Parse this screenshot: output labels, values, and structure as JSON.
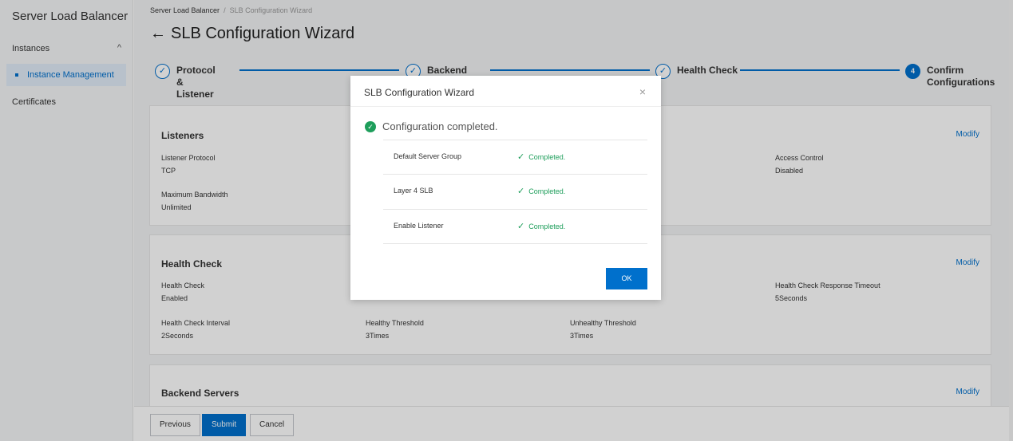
{
  "sidebar": {
    "brand": "Server Load Balancer",
    "group_label": "Instances",
    "items": [
      {
        "label": "Instance Management",
        "active": true
      },
      {
        "label": "Certificates",
        "active": false
      }
    ]
  },
  "breadcrumb": {
    "root": "Server Load Balancer",
    "separator": "/",
    "current": "SLB Configuration Wizard"
  },
  "page_title": "SLB Configuration Wizard",
  "steps": [
    {
      "label": "Protocol &\nListener",
      "state": "done"
    },
    {
      "label": "Backend",
      "state": "done"
    },
    {
      "label": "Health Check",
      "state": "done"
    },
    {
      "label": "Confirm\nConfigurations",
      "state": "current",
      "number": "4"
    }
  ],
  "cards": {
    "listeners": {
      "title": "Listeners",
      "modify": "Modify",
      "fields": [
        {
          "label": "Listener Protocol",
          "value": "TCP"
        },
        {
          "label": "Access Control",
          "value": "Disabled"
        },
        {
          "label": "Maximum Bandwidth",
          "value": "Unlimited"
        }
      ]
    },
    "health": {
      "title": "Health Check",
      "modify": "Modify",
      "fields": [
        {
          "label": "Health Check",
          "value": "Enabled"
        },
        {
          "label": "Health Check Response Timeout",
          "value": "5Seconds"
        },
        {
          "label": "Health Check Interval",
          "value": "2Seconds"
        },
        {
          "label": "Healthy Threshold",
          "value": "3Times"
        },
        {
          "label": "Unhealthy Threshold",
          "value": "3Times"
        }
      ]
    },
    "backend": {
      "title": "Backend Servers",
      "modify": "Modify"
    }
  },
  "footer": {
    "previous": "Previous",
    "submit": "Submit",
    "cancel": "Cancel"
  },
  "modal": {
    "title": "SLB Configuration Wizard",
    "close": "×",
    "status_text": "Configuration completed.",
    "rows": [
      {
        "name": "Default Server Group",
        "status": "Completed."
      },
      {
        "name": "Layer 4 SLB",
        "status": "Completed."
      },
      {
        "name": "Enable Listener",
        "status": "Completed."
      }
    ],
    "ok": "OK"
  },
  "colors": {
    "accent": "#0070cc",
    "success": "#1e9e5b"
  }
}
